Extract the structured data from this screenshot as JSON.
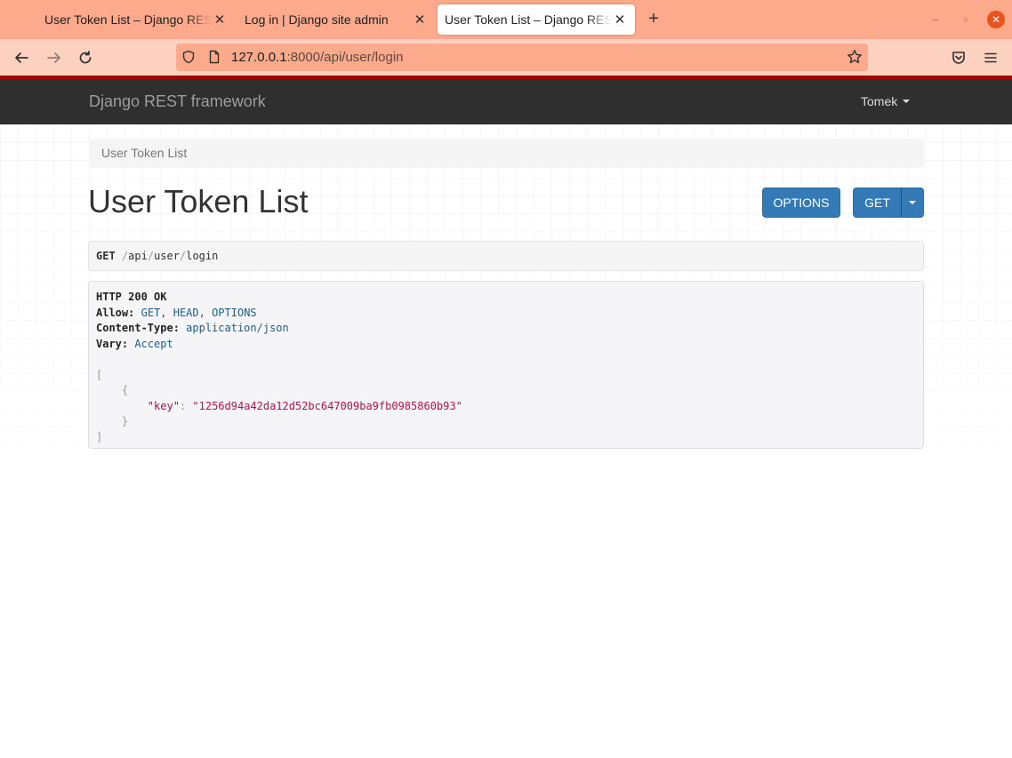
{
  "browser": {
    "tabs": [
      {
        "title": "User Token List – Django REST framework",
        "active": false
      },
      {
        "title": "Log in | Django site admin",
        "active": false
      },
      {
        "title": "User Token List – Django REST framework",
        "active": true
      }
    ],
    "url": {
      "host": "127.0.0.1",
      "rest": ":8000/api/user/login"
    },
    "accent_color": "#fca98c"
  },
  "drf": {
    "brand": "Django REST framework",
    "user": "Tomek"
  },
  "breadcrumb": "User Token List",
  "page_title": "User Token List",
  "buttons": {
    "options": "OPTIONS",
    "get": "GET"
  },
  "request": {
    "method": "GET",
    "path_parts": [
      "api",
      "user",
      "login"
    ]
  },
  "response": {
    "status": "HTTP 200 OK",
    "headers": [
      {
        "key": "Allow:",
        "value": "GET, HEAD, OPTIONS"
      },
      {
        "key": "Content-Type:",
        "value": "application/json"
      },
      {
        "key": "Vary:",
        "value": "Accept"
      }
    ],
    "body": {
      "open_list": "[",
      "open_obj": "{",
      "key": "\"key\"",
      "colon": ":",
      "value": "\"1256d94a42da12d52bc647009ba9fb0985860b93\"",
      "close_obj": "}",
      "close_list": "]"
    }
  }
}
